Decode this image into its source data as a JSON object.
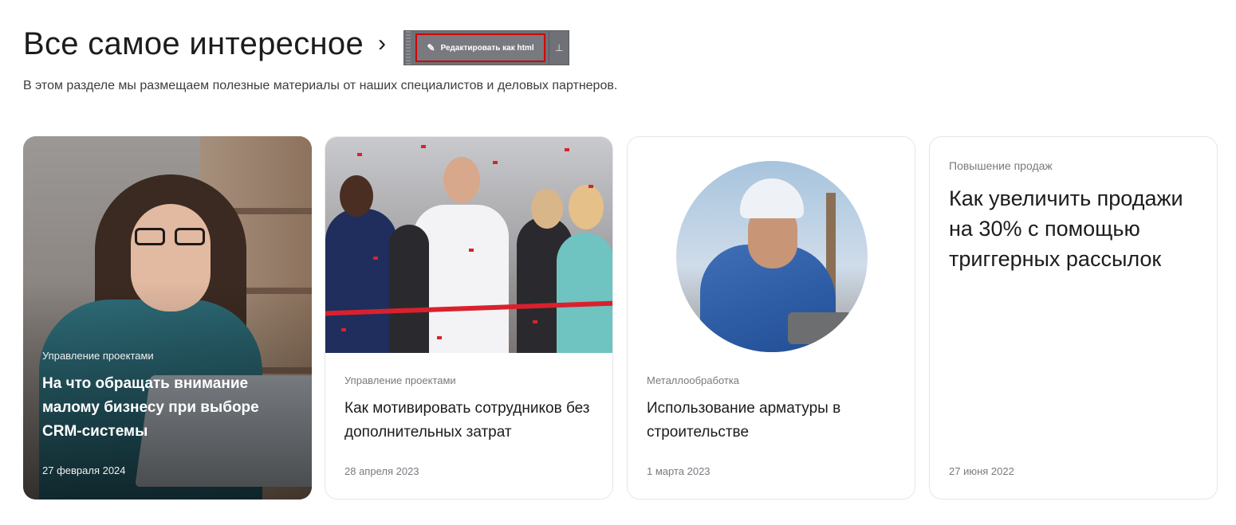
{
  "header": {
    "title": "Все самое интересное",
    "chevron": "›",
    "description": "В этом разделе мы размещаем полезные материалы от наших специалистов и деловых партнеров."
  },
  "edit_toolbar": {
    "edit_label": "Редактировать как html",
    "edit_icon": "pencil-icon",
    "pin_icon": "pin-icon"
  },
  "cards": [
    {
      "tag": "Управление проектами",
      "title": "На что обращать внимание малому бизнесу при выборе CRM-системы",
      "date": "27 февраля 2024"
    },
    {
      "tag": "Управление проектами",
      "title": "Как мотивировать сотрудников без дополнительных затрат",
      "date": "28 апреля 2023"
    },
    {
      "tag": "Металлообработка",
      "title": "Использование арматуры в строительстве",
      "date": "1 марта 2023"
    },
    {
      "tag": "Повышение продаж",
      "title": "Как увеличить продажи на 30% с помощью триггерных рассылок",
      "date": "27 июня 2022"
    }
  ],
  "colors": {
    "text": "#1c1c1c",
    "muted": "#7a7a80",
    "card_border": "#e6e6ea",
    "edit_highlight": "#d00000"
  }
}
